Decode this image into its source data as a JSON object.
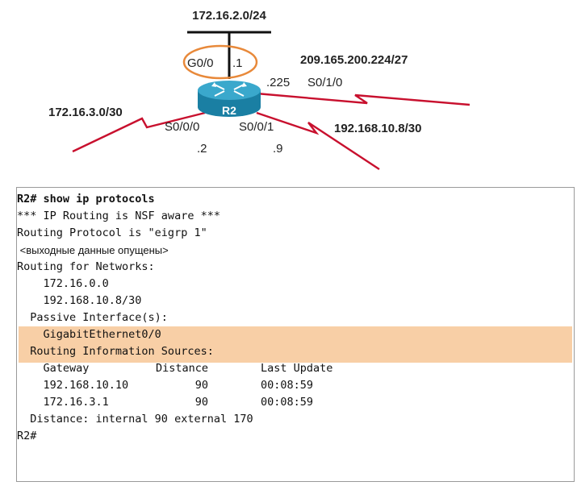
{
  "topology": {
    "top_network": "172.16.2.0/24",
    "router_name": "R2",
    "g0_interface": "G0/0",
    "g0_address": ".1",
    "isp_network": "209.165.200.224/27",
    "isp_address": ".225",
    "isp_interface": "S0/1/0",
    "left_network": "172.16.3.0/30",
    "s000_interface": "S0/0/0",
    "s000_address": ".2",
    "s001_interface": "S0/0/1",
    "s001_address": ".9",
    "right_network": "192.168.10.8/30",
    "colors": {
      "serial_link": "#c8102e",
      "highlight_circle": "#e8893a",
      "router_body": "#1a7fa3",
      "router_top": "#3aa8cc"
    }
  },
  "cli": {
    "command": "R2# show ip protocols",
    "nsf_line": "*** IP Routing is NSF aware ***",
    "protocol_line": "Routing Protocol is \"eigrp 1\"",
    "omitted_note": " <выходные данные опущены>",
    "networks_header": "Routing for Networks:",
    "network_1": "    172.16.0.0",
    "network_2": "    192.168.10.8/30",
    "passive_header": "  Passive Interface(s):",
    "passive_interface": "    GigabitEthernet0/0",
    "sources_header": "  Routing Information Sources:",
    "table_headers": [
      "    Gateway",
      "Distance",
      "Last Update"
    ],
    "table_rows": [
      [
        "    192.168.10.10",
        "      90",
        "00:08:59"
      ],
      [
        "    172.16.3.1",
        "      90",
        "00:08:59"
      ]
    ],
    "distance_line": "  Distance: internal 90 external 170",
    "prompt": "R2#",
    "highlight_color": "#f8cfa6"
  }
}
